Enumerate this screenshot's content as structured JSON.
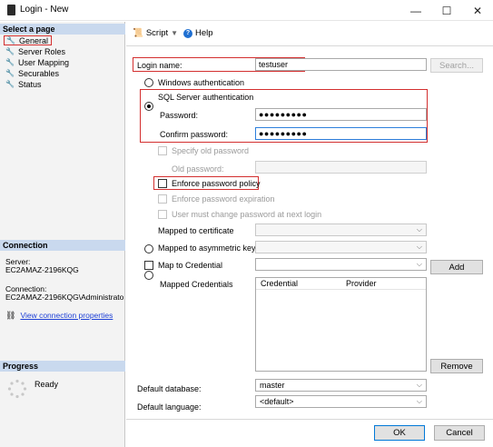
{
  "window": {
    "title": "Login - New"
  },
  "leftpanel": {
    "select_page_title": "Select a page",
    "nav_items": [
      {
        "label": "General"
      },
      {
        "label": "Server Roles"
      },
      {
        "label": "User Mapping"
      },
      {
        "label": "Securables"
      },
      {
        "label": "Status"
      }
    ],
    "connection_title": "Connection",
    "server_label": "Server:",
    "server_value": "EC2AMAZ-2196KQG",
    "connection_label": "Connection:",
    "connection_value": "EC2AMAZ-2196KQG\\Administrato",
    "view_connection_link": "View connection properties",
    "progress_title": "Progress",
    "progress_status": "Ready"
  },
  "toolbar": {
    "script_label": "Script",
    "help_label": "Help"
  },
  "form": {
    "login_name_label": "Login name:",
    "login_name_value": "testuser",
    "search_button": "Search...",
    "windows_auth_label": "Windows authentication",
    "sql_auth_label": "SQL Server authentication",
    "password_label": "Password:",
    "password_value": "●●●●●●●●●",
    "confirm_password_label": "Confirm password:",
    "confirm_password_value": "●●●●●●●●●",
    "specify_old_password_label": "Specify old password",
    "old_password_label": "Old password:",
    "enforce_policy_label": "Enforce password policy",
    "enforce_expiration_label": "Enforce password expiration",
    "must_change_label": "User must change password at next login",
    "mapped_certificate_label": "Mapped to certificate",
    "mapped_asymmetric_label": "Mapped to asymmetric key",
    "map_credential_label": "Map to Credential",
    "add_button": "Add",
    "mapped_credentials_label": "Mapped Credentials",
    "credentials_columns": [
      "Credential",
      "Provider"
    ],
    "remove_button": "Remove",
    "default_database_label": "Default database:",
    "default_database_value": "master",
    "default_language_label": "Default language:",
    "default_language_value": "<default>"
  },
  "footer": {
    "ok_button": "OK",
    "cancel_button": "Cancel"
  }
}
